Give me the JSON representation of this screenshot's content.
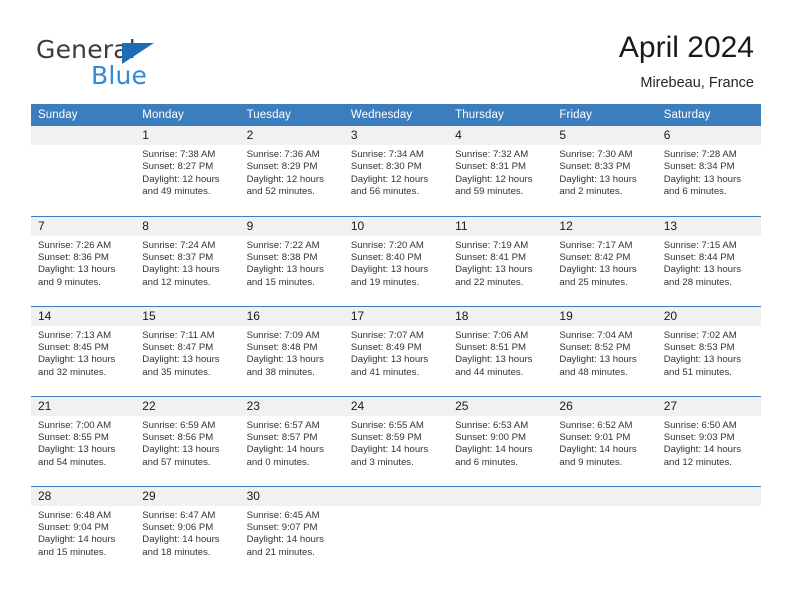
{
  "logo": {
    "primary_text": "General",
    "secondary_text": "Blue",
    "primary_color": "#3c3c3c",
    "secondary_color": "#2e8bd8",
    "triangle_color": "#1e6cb5"
  },
  "header": {
    "title": "April 2024",
    "subtitle": "Mirebeau, France"
  },
  "theme": {
    "header_bg": "#3c7ebd",
    "header_text": "#ffffff",
    "daynum_bg": "#f1f1f1",
    "row_divider": "#3c7ebd",
    "body_text": "#333333"
  },
  "calendar": {
    "weekday_headers": [
      "Sunday",
      "Monday",
      "Tuesday",
      "Wednesday",
      "Thursday",
      "Friday",
      "Saturday"
    ],
    "weeks": [
      [
        {
          "day": "",
          "blank": true,
          "sunrise": "",
          "sunset": "",
          "daylight_line1": "",
          "daylight_line2": ""
        },
        {
          "day": "1",
          "blank": false,
          "sunrise": "Sunrise: 7:38 AM",
          "sunset": "Sunset: 8:27 PM",
          "daylight_line1": "Daylight: 12 hours",
          "daylight_line2": "and 49 minutes."
        },
        {
          "day": "2",
          "blank": false,
          "sunrise": "Sunrise: 7:36 AM",
          "sunset": "Sunset: 8:29 PM",
          "daylight_line1": "Daylight: 12 hours",
          "daylight_line2": "and 52 minutes."
        },
        {
          "day": "3",
          "blank": false,
          "sunrise": "Sunrise: 7:34 AM",
          "sunset": "Sunset: 8:30 PM",
          "daylight_line1": "Daylight: 12 hours",
          "daylight_line2": "and 56 minutes."
        },
        {
          "day": "4",
          "blank": false,
          "sunrise": "Sunrise: 7:32 AM",
          "sunset": "Sunset: 8:31 PM",
          "daylight_line1": "Daylight: 12 hours",
          "daylight_line2": "and 59 minutes."
        },
        {
          "day": "5",
          "blank": false,
          "sunrise": "Sunrise: 7:30 AM",
          "sunset": "Sunset: 8:33 PM",
          "daylight_line1": "Daylight: 13 hours",
          "daylight_line2": "and 2 minutes."
        },
        {
          "day": "6",
          "blank": false,
          "sunrise": "Sunrise: 7:28 AM",
          "sunset": "Sunset: 8:34 PM",
          "daylight_line1": "Daylight: 13 hours",
          "daylight_line2": "and 6 minutes."
        }
      ],
      [
        {
          "day": "7",
          "blank": false,
          "sunrise": "Sunrise: 7:26 AM",
          "sunset": "Sunset: 8:36 PM",
          "daylight_line1": "Daylight: 13 hours",
          "daylight_line2": "and 9 minutes."
        },
        {
          "day": "8",
          "blank": false,
          "sunrise": "Sunrise: 7:24 AM",
          "sunset": "Sunset: 8:37 PM",
          "daylight_line1": "Daylight: 13 hours",
          "daylight_line2": "and 12 minutes."
        },
        {
          "day": "9",
          "blank": false,
          "sunrise": "Sunrise: 7:22 AM",
          "sunset": "Sunset: 8:38 PM",
          "daylight_line1": "Daylight: 13 hours",
          "daylight_line2": "and 15 minutes."
        },
        {
          "day": "10",
          "blank": false,
          "sunrise": "Sunrise: 7:20 AM",
          "sunset": "Sunset: 8:40 PM",
          "daylight_line1": "Daylight: 13 hours",
          "daylight_line2": "and 19 minutes."
        },
        {
          "day": "11",
          "blank": false,
          "sunrise": "Sunrise: 7:19 AM",
          "sunset": "Sunset: 8:41 PM",
          "daylight_line1": "Daylight: 13 hours",
          "daylight_line2": "and 22 minutes."
        },
        {
          "day": "12",
          "blank": false,
          "sunrise": "Sunrise: 7:17 AM",
          "sunset": "Sunset: 8:42 PM",
          "daylight_line1": "Daylight: 13 hours",
          "daylight_line2": "and 25 minutes."
        },
        {
          "day": "13",
          "blank": false,
          "sunrise": "Sunrise: 7:15 AM",
          "sunset": "Sunset: 8:44 PM",
          "daylight_line1": "Daylight: 13 hours",
          "daylight_line2": "and 28 minutes."
        }
      ],
      [
        {
          "day": "14",
          "blank": false,
          "sunrise": "Sunrise: 7:13 AM",
          "sunset": "Sunset: 8:45 PM",
          "daylight_line1": "Daylight: 13 hours",
          "daylight_line2": "and 32 minutes."
        },
        {
          "day": "15",
          "blank": false,
          "sunrise": "Sunrise: 7:11 AM",
          "sunset": "Sunset: 8:47 PM",
          "daylight_line1": "Daylight: 13 hours",
          "daylight_line2": "and 35 minutes."
        },
        {
          "day": "16",
          "blank": false,
          "sunrise": "Sunrise: 7:09 AM",
          "sunset": "Sunset: 8:48 PM",
          "daylight_line1": "Daylight: 13 hours",
          "daylight_line2": "and 38 minutes."
        },
        {
          "day": "17",
          "blank": false,
          "sunrise": "Sunrise: 7:07 AM",
          "sunset": "Sunset: 8:49 PM",
          "daylight_line1": "Daylight: 13 hours",
          "daylight_line2": "and 41 minutes."
        },
        {
          "day": "18",
          "blank": false,
          "sunrise": "Sunrise: 7:06 AM",
          "sunset": "Sunset: 8:51 PM",
          "daylight_line1": "Daylight: 13 hours",
          "daylight_line2": "and 44 minutes."
        },
        {
          "day": "19",
          "blank": false,
          "sunrise": "Sunrise: 7:04 AM",
          "sunset": "Sunset: 8:52 PM",
          "daylight_line1": "Daylight: 13 hours",
          "daylight_line2": "and 48 minutes."
        },
        {
          "day": "20",
          "blank": false,
          "sunrise": "Sunrise: 7:02 AM",
          "sunset": "Sunset: 8:53 PM",
          "daylight_line1": "Daylight: 13 hours",
          "daylight_line2": "and 51 minutes."
        }
      ],
      [
        {
          "day": "21",
          "blank": false,
          "sunrise": "Sunrise: 7:00 AM",
          "sunset": "Sunset: 8:55 PM",
          "daylight_line1": "Daylight: 13 hours",
          "daylight_line2": "and 54 minutes."
        },
        {
          "day": "22",
          "blank": false,
          "sunrise": "Sunrise: 6:59 AM",
          "sunset": "Sunset: 8:56 PM",
          "daylight_line1": "Daylight: 13 hours",
          "daylight_line2": "and 57 minutes."
        },
        {
          "day": "23",
          "blank": false,
          "sunrise": "Sunrise: 6:57 AM",
          "sunset": "Sunset: 8:57 PM",
          "daylight_line1": "Daylight: 14 hours",
          "daylight_line2": "and 0 minutes."
        },
        {
          "day": "24",
          "blank": false,
          "sunrise": "Sunrise: 6:55 AM",
          "sunset": "Sunset: 8:59 PM",
          "daylight_line1": "Daylight: 14 hours",
          "daylight_line2": "and 3 minutes."
        },
        {
          "day": "25",
          "blank": false,
          "sunrise": "Sunrise: 6:53 AM",
          "sunset": "Sunset: 9:00 PM",
          "daylight_line1": "Daylight: 14 hours",
          "daylight_line2": "and 6 minutes."
        },
        {
          "day": "26",
          "blank": false,
          "sunrise": "Sunrise: 6:52 AM",
          "sunset": "Sunset: 9:01 PM",
          "daylight_line1": "Daylight: 14 hours",
          "daylight_line2": "and 9 minutes."
        },
        {
          "day": "27",
          "blank": false,
          "sunrise": "Sunrise: 6:50 AM",
          "sunset": "Sunset: 9:03 PM",
          "daylight_line1": "Daylight: 14 hours",
          "daylight_line2": "and 12 minutes."
        }
      ],
      [
        {
          "day": "28",
          "blank": false,
          "sunrise": "Sunrise: 6:48 AM",
          "sunset": "Sunset: 9:04 PM",
          "daylight_line1": "Daylight: 14 hours",
          "daylight_line2": "and 15 minutes."
        },
        {
          "day": "29",
          "blank": false,
          "sunrise": "Sunrise: 6:47 AM",
          "sunset": "Sunset: 9:06 PM",
          "daylight_line1": "Daylight: 14 hours",
          "daylight_line2": "and 18 minutes."
        },
        {
          "day": "30",
          "blank": false,
          "sunrise": "Sunrise: 6:45 AM",
          "sunset": "Sunset: 9:07 PM",
          "daylight_line1": "Daylight: 14 hours",
          "daylight_line2": "and 21 minutes."
        },
        {
          "day": "",
          "blank": true,
          "sunrise": "",
          "sunset": "",
          "daylight_line1": "",
          "daylight_line2": ""
        },
        {
          "day": "",
          "blank": true,
          "sunrise": "",
          "sunset": "",
          "daylight_line1": "",
          "daylight_line2": ""
        },
        {
          "day": "",
          "blank": true,
          "sunrise": "",
          "sunset": "",
          "daylight_line1": "",
          "daylight_line2": ""
        },
        {
          "day": "",
          "blank": true,
          "sunrise": "",
          "sunset": "",
          "daylight_line1": "",
          "daylight_line2": ""
        }
      ]
    ]
  }
}
